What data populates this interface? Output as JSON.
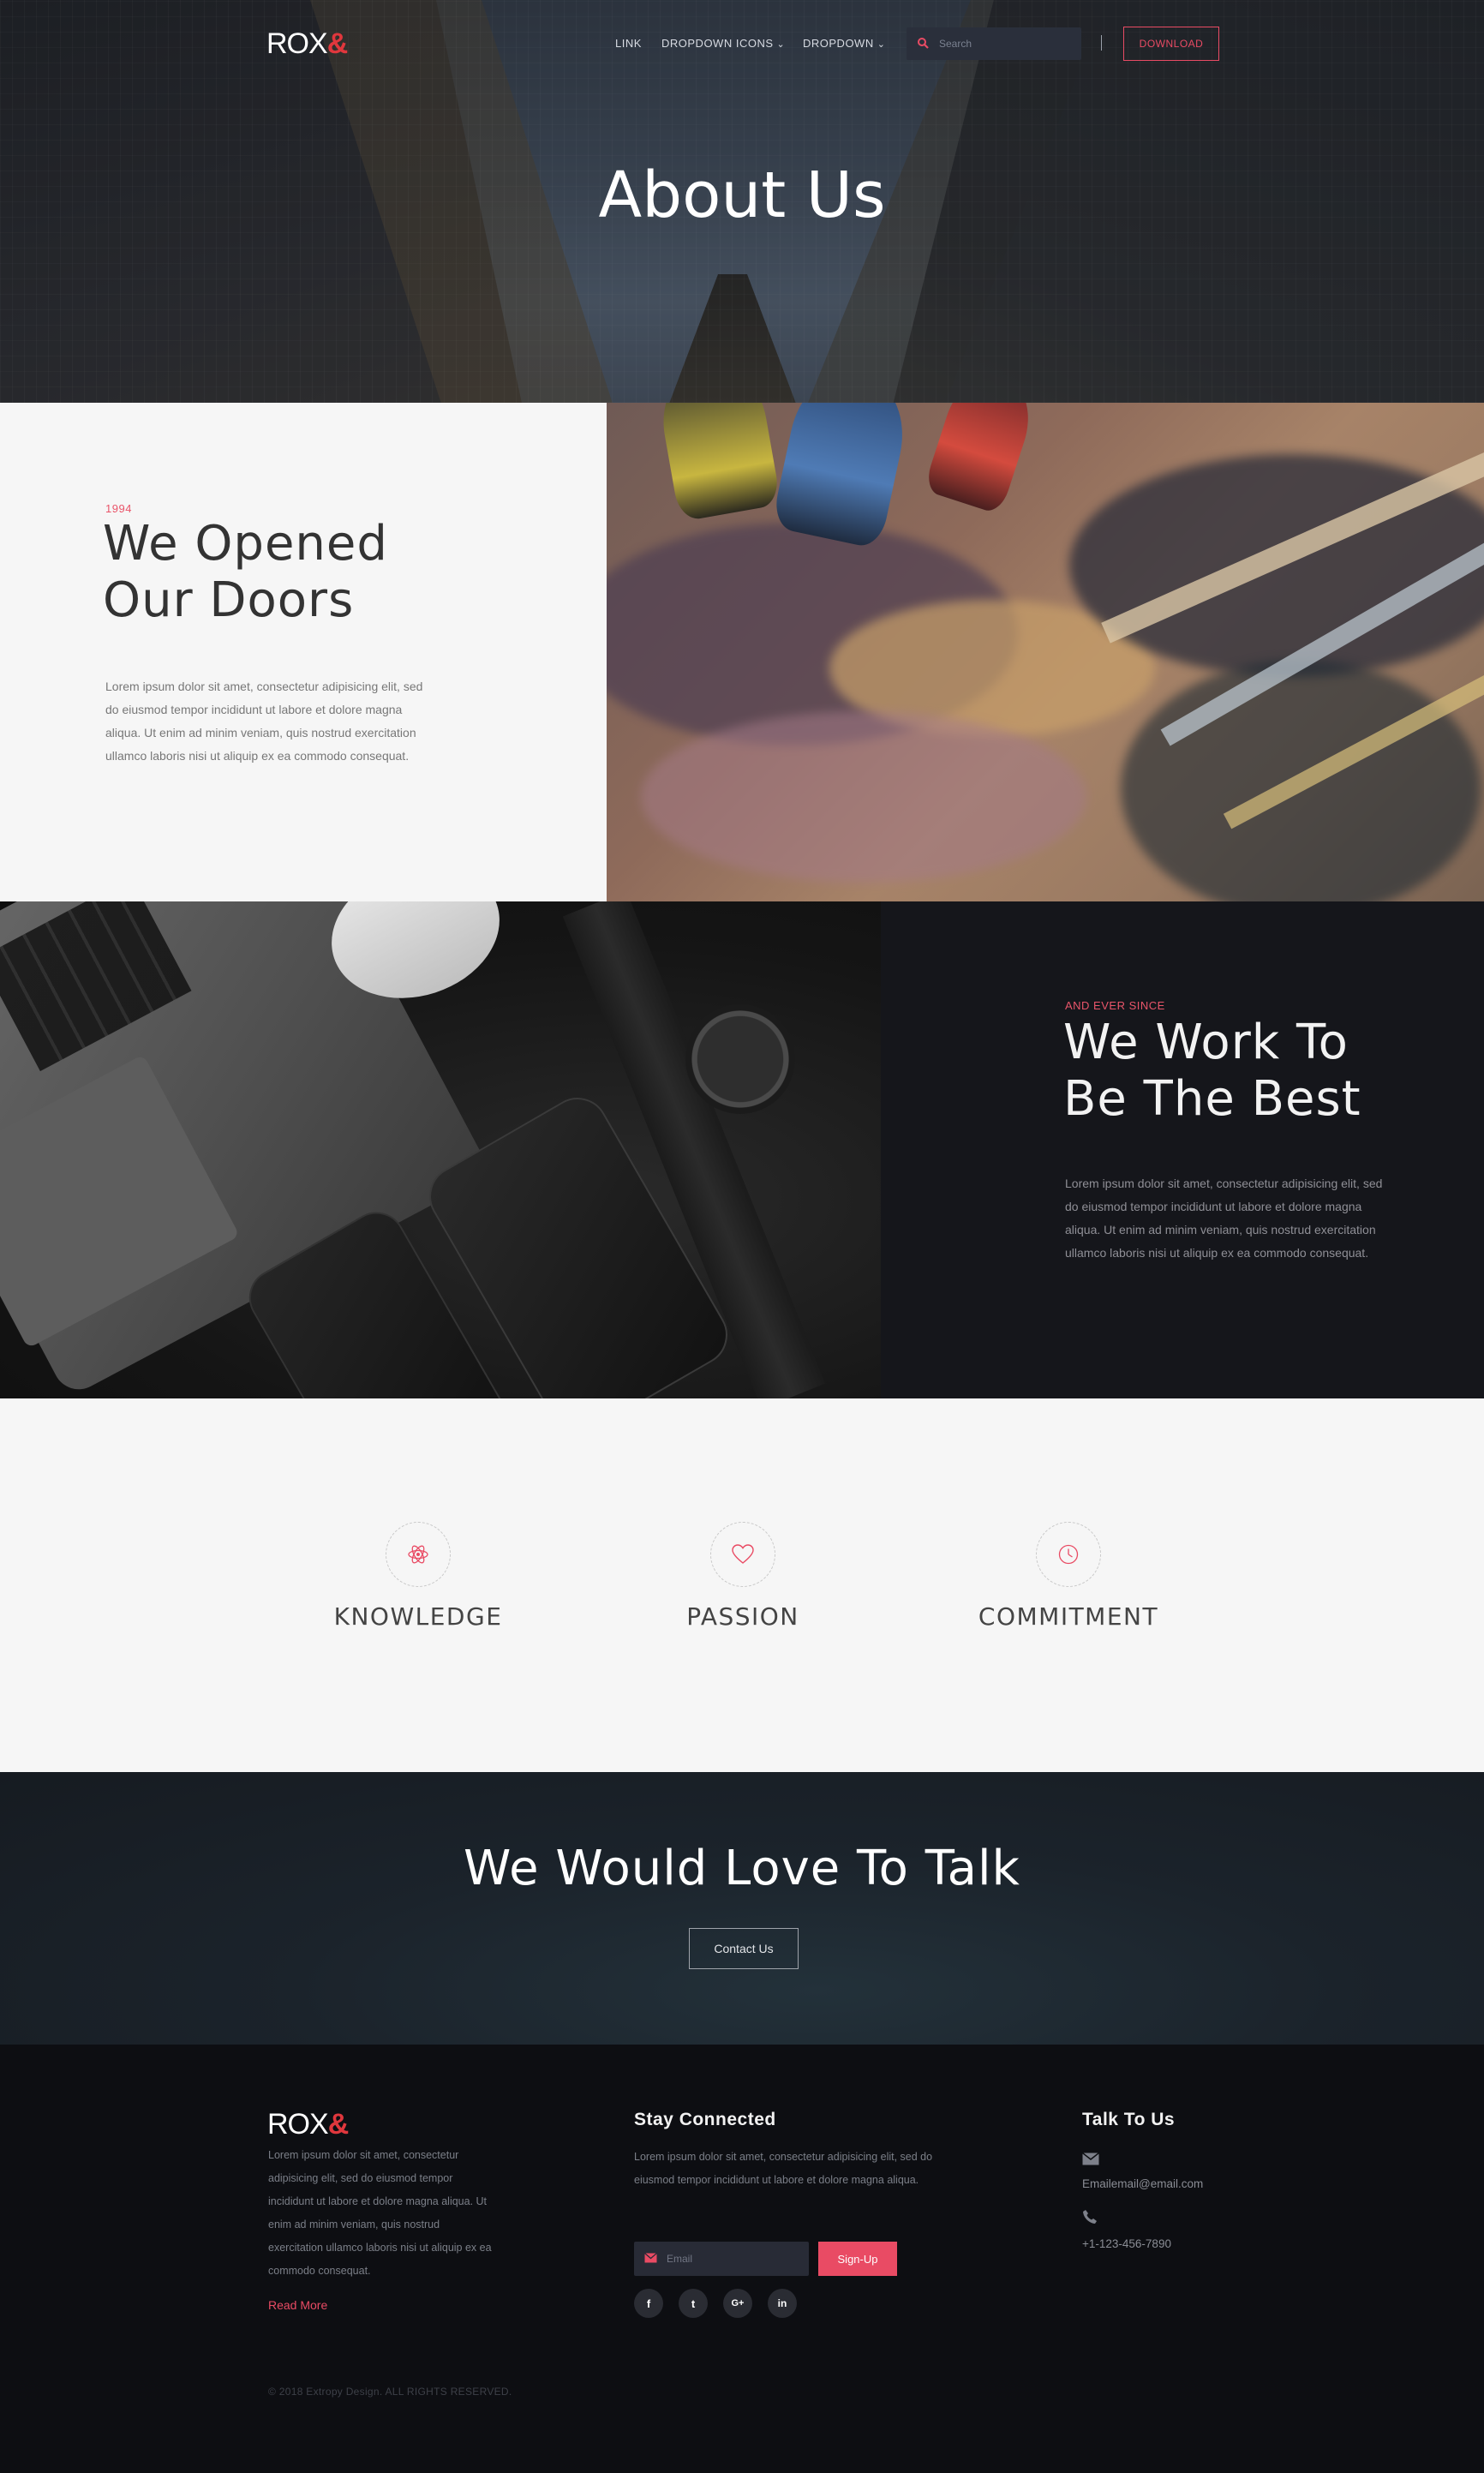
{
  "brand": {
    "name": "ROX",
    "amp": "&"
  },
  "nav": {
    "links": [
      {
        "label": "LINK"
      },
      {
        "label": "DROPDOWN ICONS"
      },
      {
        "label": "DROPDOWN"
      }
    ],
    "search_placeholder": "Search",
    "download_label": "DOWNLOAD"
  },
  "hero": {
    "title": "About Us"
  },
  "opened": {
    "kicker": "1994",
    "title_line1": "We Opened",
    "title_line2": "Our Doors",
    "text": "Lorem ipsum dolor sit amet, consectetur adipisicing elit, sed do eiusmod tempor incididunt ut labore et dolore magna aliqua. Ut enim ad minim veniam, quis nostrud exercitation ullamco laboris nisi ut aliquip ex ea commodo consequat."
  },
  "best": {
    "kicker": "AND EVER SINCE",
    "title_line1": "We Work To",
    "title_line2": "Be The Best",
    "text": "Lorem ipsum dolor sit amet, consectetur adipisicing elit, sed do eiusmod tempor incididunt ut labore et dolore magna aliqua. Ut enim ad minim veniam, quis nostrud exercitation ullamco laboris nisi ut aliquip ex ea commodo consequat."
  },
  "values": [
    {
      "label": "KNOWLEDGE",
      "icon": "atom-icon"
    },
    {
      "label": "PASSION",
      "icon": "heart-icon"
    },
    {
      "label": "COMMITMENT",
      "icon": "clock-icon"
    }
  ],
  "cta": {
    "title": "We Would Love To Talk",
    "button": "Contact Us"
  },
  "footer": {
    "about_text": "Lorem ipsum dolor sit amet, consectetur adipisicing elit, sed do eiusmod tempor incididunt ut labore et dolore magna aliqua. Ut enim ad minim veniam, quis nostrud exercitation ullamco laboris nisi ut aliquip ex ea commodo consequat.",
    "read_more": "Read More",
    "stay_title": "Stay Connected",
    "stay_text": "Lorem ipsum dolor sit amet, consectetur adipisicing elit, sed do eiusmod tempor incididunt ut labore et dolore magna aliqua.",
    "email_placeholder": "Email",
    "signup": "Sign-Up",
    "social": [
      {
        "label": "f",
        "icon": "facebook-icon"
      },
      {
        "label": "t",
        "icon": "twitter-icon"
      },
      {
        "label": "G+",
        "icon": "google-plus-icon"
      },
      {
        "label": "in",
        "icon": "linkedin-icon"
      }
    ],
    "talk_title": "Talk To Us",
    "email": "Emailemail@email.com",
    "phone": "+1-123-456-7890",
    "copyright": "© 2018 Extropy Design. ALL RIGHTS RESERVED."
  },
  "colors": {
    "accent": "#e94b64",
    "brand_amp": "#e0373d",
    "dark_bg": "#15161b",
    "footer_bg": "#0d0e12"
  }
}
